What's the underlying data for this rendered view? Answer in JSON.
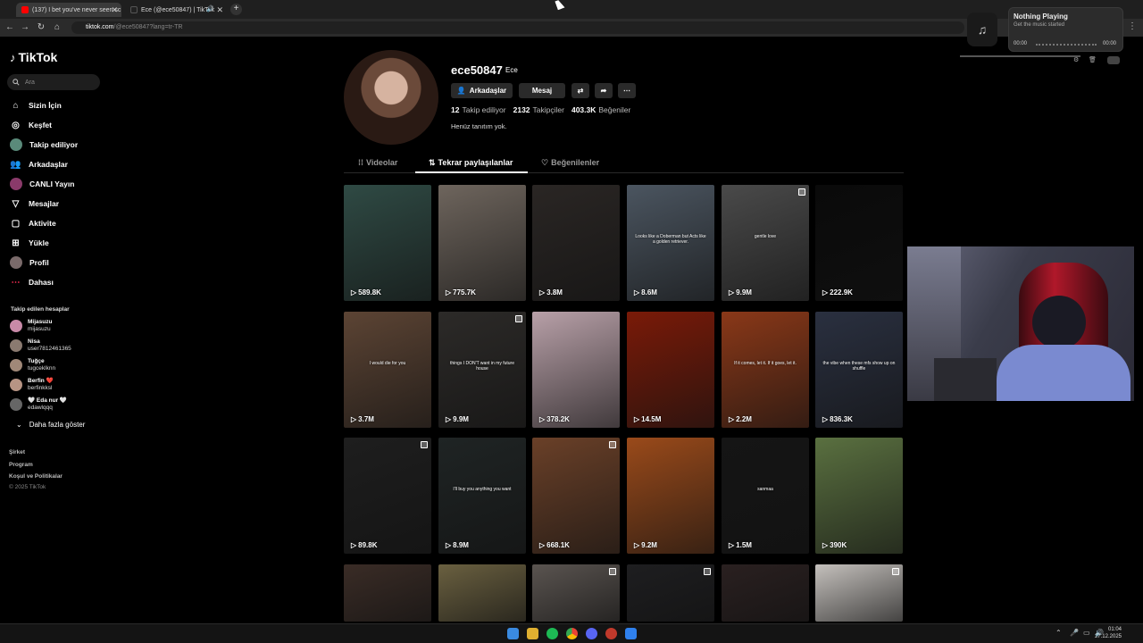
{
  "browser": {
    "tabs": [
      {
        "title": "(137) I bet you've never seen sc",
        "favicon_color": "#ff0000"
      },
      {
        "title": "Ece (@ece50847) | TikTok",
        "favicon_color": "#111111"
      }
    ],
    "url_host": "tiktok.com",
    "url_path": "/@ece50847?lang=tr-TR"
  },
  "sidebar": {
    "logo": "TikTok",
    "search_placeholder": "Ara",
    "nav": [
      {
        "label": "Sizin İçin",
        "icon": "home-icon"
      },
      {
        "label": "Keşfet",
        "icon": "compass-icon"
      },
      {
        "label": "Takip ediliyor",
        "icon": "following-avatar"
      },
      {
        "label": "Arkadaşlar",
        "icon": "friends-icon"
      },
      {
        "label": "CANLI Yayın",
        "icon": "live-avatar"
      },
      {
        "label": "Mesajlar",
        "icon": "messages-icon"
      },
      {
        "label": "Aktivite",
        "icon": "activity-icon"
      },
      {
        "label": "Yükle",
        "icon": "upload-icon"
      },
      {
        "label": "Profil",
        "icon": "profile-avatar"
      },
      {
        "label": "Dahası",
        "icon": "more-icon"
      }
    ],
    "following_title": "Takip edilen hesaplar",
    "accounts": [
      {
        "name": "Mijasuzu",
        "handle": "mijasuzu",
        "color": "#c98aa8"
      },
      {
        "name": "Nisa",
        "handle": "user7812461365",
        "color": "#8a7a70"
      },
      {
        "name": "Tuğçe",
        "handle": "tugceklknn",
        "color": "#a08878"
      },
      {
        "name": "Berfin ❤️",
        "handle": "berfinkksl",
        "color": "#b79484"
      },
      {
        "name": "🤍 Eda nur 🤍",
        "handle": "edawlqqq",
        "color": "#666"
      }
    ],
    "show_more": "Daha fazla göster",
    "footer": [
      "Şirket",
      "Program",
      "Koşul ve Politikalar",
      "© 2025 TikTok"
    ]
  },
  "profile": {
    "username": "ece50847",
    "nickname": "Ece",
    "buttons": {
      "friends": "Arkadaşlar",
      "message": "Mesaj"
    },
    "stats": {
      "following": "12",
      "following_label": "Takip ediliyor",
      "followers": "2132",
      "followers_label": "Takipçiler",
      "likes": "403.3K",
      "likes_label": "Beğeniler"
    },
    "bio": "Henüz tanıtım yok.",
    "tabs": {
      "videos": "Videolar",
      "reposts": "Tekrar paylaşılanlar",
      "liked": "Beğenilenler"
    }
  },
  "videos": [
    {
      "views": "589.8K",
      "bg": "#2f4a44",
      "caption": "",
      "multi": false
    },
    {
      "views": "775.7K",
      "bg": "#6e655d",
      "caption": "",
      "multi": false
    },
    {
      "views": "3.8M",
      "bg": "#2a2624",
      "caption": "",
      "multi": false
    },
    {
      "views": "8.6M",
      "bg": "#4b5560",
      "caption": "Looks like a Doberman but Acts like a golden retriever.",
      "multi": false
    },
    {
      "views": "9.9M",
      "bg": "#4a4a4a",
      "caption": "gentle love",
      "multi": true
    },
    {
      "views": "222.9K",
      "bg": "#0a0a0a",
      "caption": "",
      "multi": false
    },
    {
      "views": "3.7M",
      "bg": "#5c4434",
      "caption": "I would die for you",
      "multi": false
    },
    {
      "views": "9.9M",
      "bg": "#2c2a28",
      "caption": "things I DON'T want in my future house",
      "multi": true
    },
    {
      "views": "378.2K",
      "bg": "#b8a0a8",
      "caption": "",
      "multi": false
    },
    {
      "views": "14.5M",
      "bg": "#7a1a08",
      "caption": "",
      "multi": false
    },
    {
      "views": "2.2M",
      "bg": "#8a3818",
      "caption": "If it comes, let it. If it goes, let it.",
      "multi": false
    },
    {
      "views": "836.3K",
      "bg": "#2a3040",
      "caption": "the vibe when these mfs show up on shuffle",
      "multi": false
    },
    {
      "views": "89.8K",
      "bg": "#1e1e1e",
      "caption": "",
      "multi": true
    },
    {
      "views": "8.9M",
      "bg": "#1f2424",
      "caption": "I'll buy you anything you want",
      "multi": false
    },
    {
      "views": "668.1K",
      "bg": "#6a4028",
      "caption": "",
      "multi": true
    },
    {
      "views": "9.2M",
      "bg": "#9a4a1a",
      "caption": "",
      "multi": false
    },
    {
      "views": "1.5M",
      "bg": "#151515",
      "caption": "sanmaa",
      "multi": false
    },
    {
      "views": "390K",
      "bg": "#5a7040",
      "caption": "",
      "multi": false
    },
    {
      "views": "",
      "bg": "#3a2c26",
      "caption": "",
      "multi": false
    },
    {
      "views": "",
      "bg": "#6a6040",
      "caption": "",
      "multi": false
    },
    {
      "views": "",
      "bg": "#5a5450",
      "caption": "",
      "multi": true
    },
    {
      "views": "",
      "bg": "#1e1e20",
      "caption": "",
      "multi": true
    },
    {
      "views": "",
      "bg": "#2a2020",
      "caption": "",
      "multi": false
    },
    {
      "views": "",
      "bg": "#c4c0bc",
      "caption": "",
      "multi": true
    }
  ],
  "music": {
    "title": "Nothing Playing",
    "subtitle": "Get the music started",
    "time_start": "00:00",
    "time_end": "00:00"
  },
  "taskbar": {
    "time": "01:04",
    "date": "27.12.2025"
  }
}
